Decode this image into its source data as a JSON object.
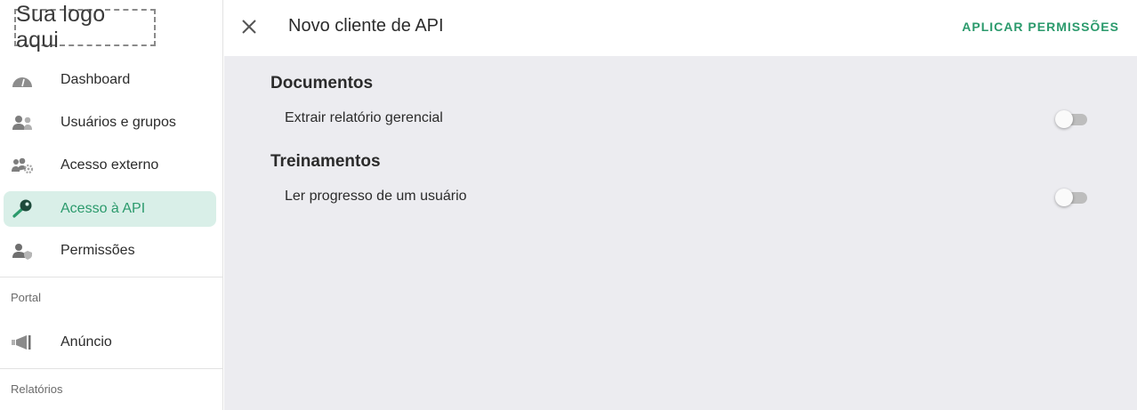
{
  "brand": {
    "logo_text": "Sua logo aqui"
  },
  "sidebar": {
    "items": [
      {
        "label": "Dashboard",
        "icon": "dashboard-gauge-icon",
        "active": false
      },
      {
        "label": "Usuários e grupos",
        "icon": "users-group-icon",
        "active": false
      },
      {
        "label": "Acesso externo",
        "icon": "users-gear-icon",
        "active": false
      },
      {
        "label": "Acesso à API",
        "icon": "key-icon",
        "active": true
      },
      {
        "label": "Permissões",
        "icon": "user-shield-icon",
        "active": false
      }
    ],
    "sections": [
      {
        "title": "Portal",
        "items": [
          {
            "label": "Anúncio",
            "icon": "megaphone-icon"
          }
        ]
      },
      {
        "title": "Relatórios",
        "items": []
      }
    ]
  },
  "header": {
    "title": "Novo cliente de API",
    "apply_label": "APLICAR PERMISSÕES",
    "close_icon": "close-icon"
  },
  "permissions": {
    "groups": [
      {
        "title": "Documentos",
        "items": [
          {
            "label": "Extrair relatório gerencial",
            "enabled": false
          }
        ]
      },
      {
        "title": "Treinamentos",
        "items": [
          {
            "label": "Ler progresso de um usuário",
            "enabled": false
          }
        ]
      }
    ]
  },
  "colors": {
    "accent": "#2b9a6c",
    "active_bg": "#d9efe8",
    "content_bg": "#ececf0",
    "toggle_off_track": "#bdbdbd"
  }
}
